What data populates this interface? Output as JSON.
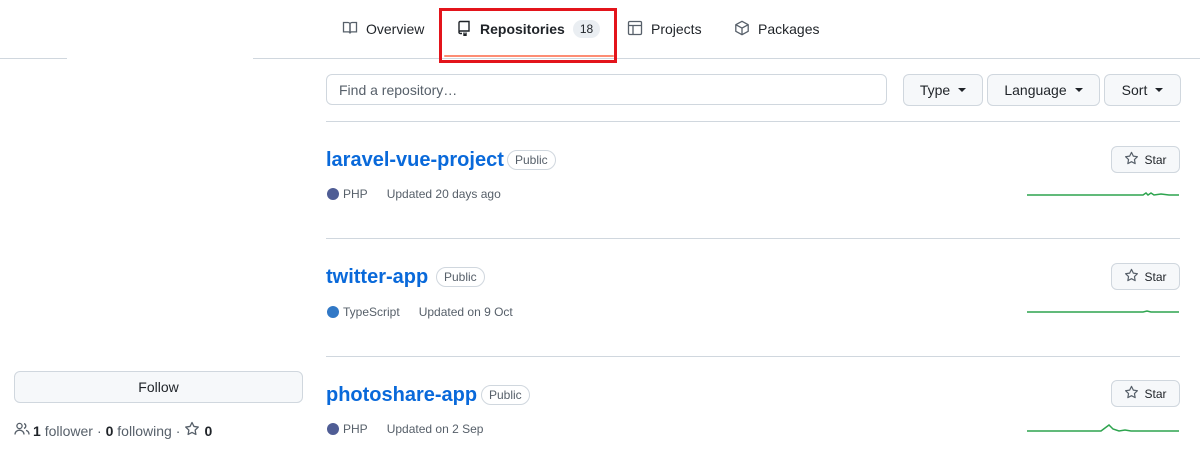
{
  "nav": {
    "tabs": [
      {
        "label": "Overview",
        "icon": "book-icon"
      },
      {
        "label": "Repositories",
        "icon": "repo-icon",
        "count": "18",
        "selected": true
      },
      {
        "label": "Projects",
        "icon": "table-icon"
      },
      {
        "label": "Packages",
        "icon": "package-icon"
      }
    ],
    "selected_underline_color": "#fd8c73",
    "highlight_box_color": "#e3141b"
  },
  "filters": {
    "search_placeholder": "Find a repository…",
    "type_label": "Type",
    "language_label": "Language",
    "sort_label": "Sort"
  },
  "repos": [
    {
      "name": "laravel-vue-project",
      "visibility": "Public",
      "language": "PHP",
      "language_color": "#4f5d95",
      "updated": "Updated 20 days ago",
      "star_label": "Star"
    },
    {
      "name": "twitter-app",
      "visibility": "Public",
      "language": "TypeScript",
      "language_color": "#3178c6",
      "updated": "Updated on 9 Oct",
      "star_label": "Star"
    },
    {
      "name": "photoshare-app",
      "visibility": "Public",
      "language": "PHP",
      "language_color": "#4f5d95",
      "updated": "Updated on 2 Sep",
      "star_label": "Star"
    }
  ],
  "sidebar": {
    "follow_label": "Follow",
    "followers_count": "1",
    "followers_label": "follower",
    "following_count": "0",
    "following_label": "following",
    "stars_count": "0",
    "separator": "·"
  },
  "colors": {
    "link": "#0969da",
    "sparkline": "#2da44e",
    "border": "#d0d7de"
  }
}
